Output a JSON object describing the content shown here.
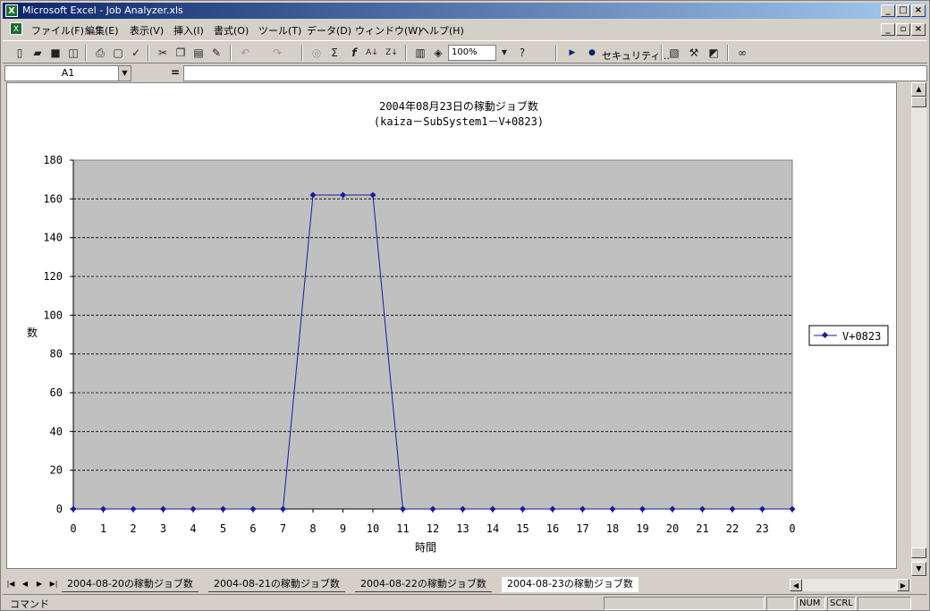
{
  "window": {
    "title": "Microsoft Excel - Job Analyzer.xls",
    "app_icon": "excel-icon",
    "controls": [
      "_",
      "□",
      "×"
    ],
    "doc_controls": [
      "_",
      "▫",
      "×"
    ]
  },
  "menu": [
    "ファイル(F)",
    "編集(E)",
    "表示(V)",
    "挿入(I)",
    "書式(O)",
    "ツール(T)",
    "データ(D)",
    "ウィンドウ(W)",
    "ヘルプ(H)"
  ],
  "toolbar": {
    "zoom": "100%",
    "security_label": "セキュリティ..."
  },
  "formula_bar": {
    "name_box": "A1",
    "equals": "="
  },
  "chart_data": {
    "type": "line",
    "title": "2004年08月23日の稼動ジョブ数",
    "subtitle": "(kaiza－SubSystem1－V+0823)",
    "xlabel": "時間",
    "ylabel": "数",
    "categories": [
      "0",
      "1",
      "2",
      "3",
      "4",
      "5",
      "6",
      "7",
      "8",
      "9",
      "10",
      "11",
      "12",
      "13",
      "14",
      "15",
      "16",
      "17",
      "18",
      "19",
      "20",
      "21",
      "22",
      "23",
      "0"
    ],
    "series": [
      {
        "name": "V+0823",
        "values": [
          0,
          0,
          0,
          0,
          0,
          0,
          0,
          0,
          162,
          162,
          162,
          0,
          0,
          0,
          0,
          0,
          0,
          0,
          0,
          0,
          0,
          0,
          0,
          0,
          0
        ],
        "color": "#1a1aa0"
      }
    ],
    "ylim": [
      0,
      180
    ],
    "yticks": [
      0,
      20,
      40,
      60,
      80,
      100,
      120,
      140,
      160,
      180
    ],
    "plot_bg": "#c0c0c0",
    "grid": "dashed horizontal",
    "legend": "right"
  },
  "sheet_tabs": [
    "2004-08-20の稼動ジョブ数",
    "2004-08-21の稼動ジョブ数",
    "2004-08-22の稼動ジョブ数",
    "2004-08-23の稼動ジョブ数"
  ],
  "active_tab": 3,
  "status": {
    "mode": "コマンド",
    "num": "NUM",
    "scrl": "SCRL"
  }
}
